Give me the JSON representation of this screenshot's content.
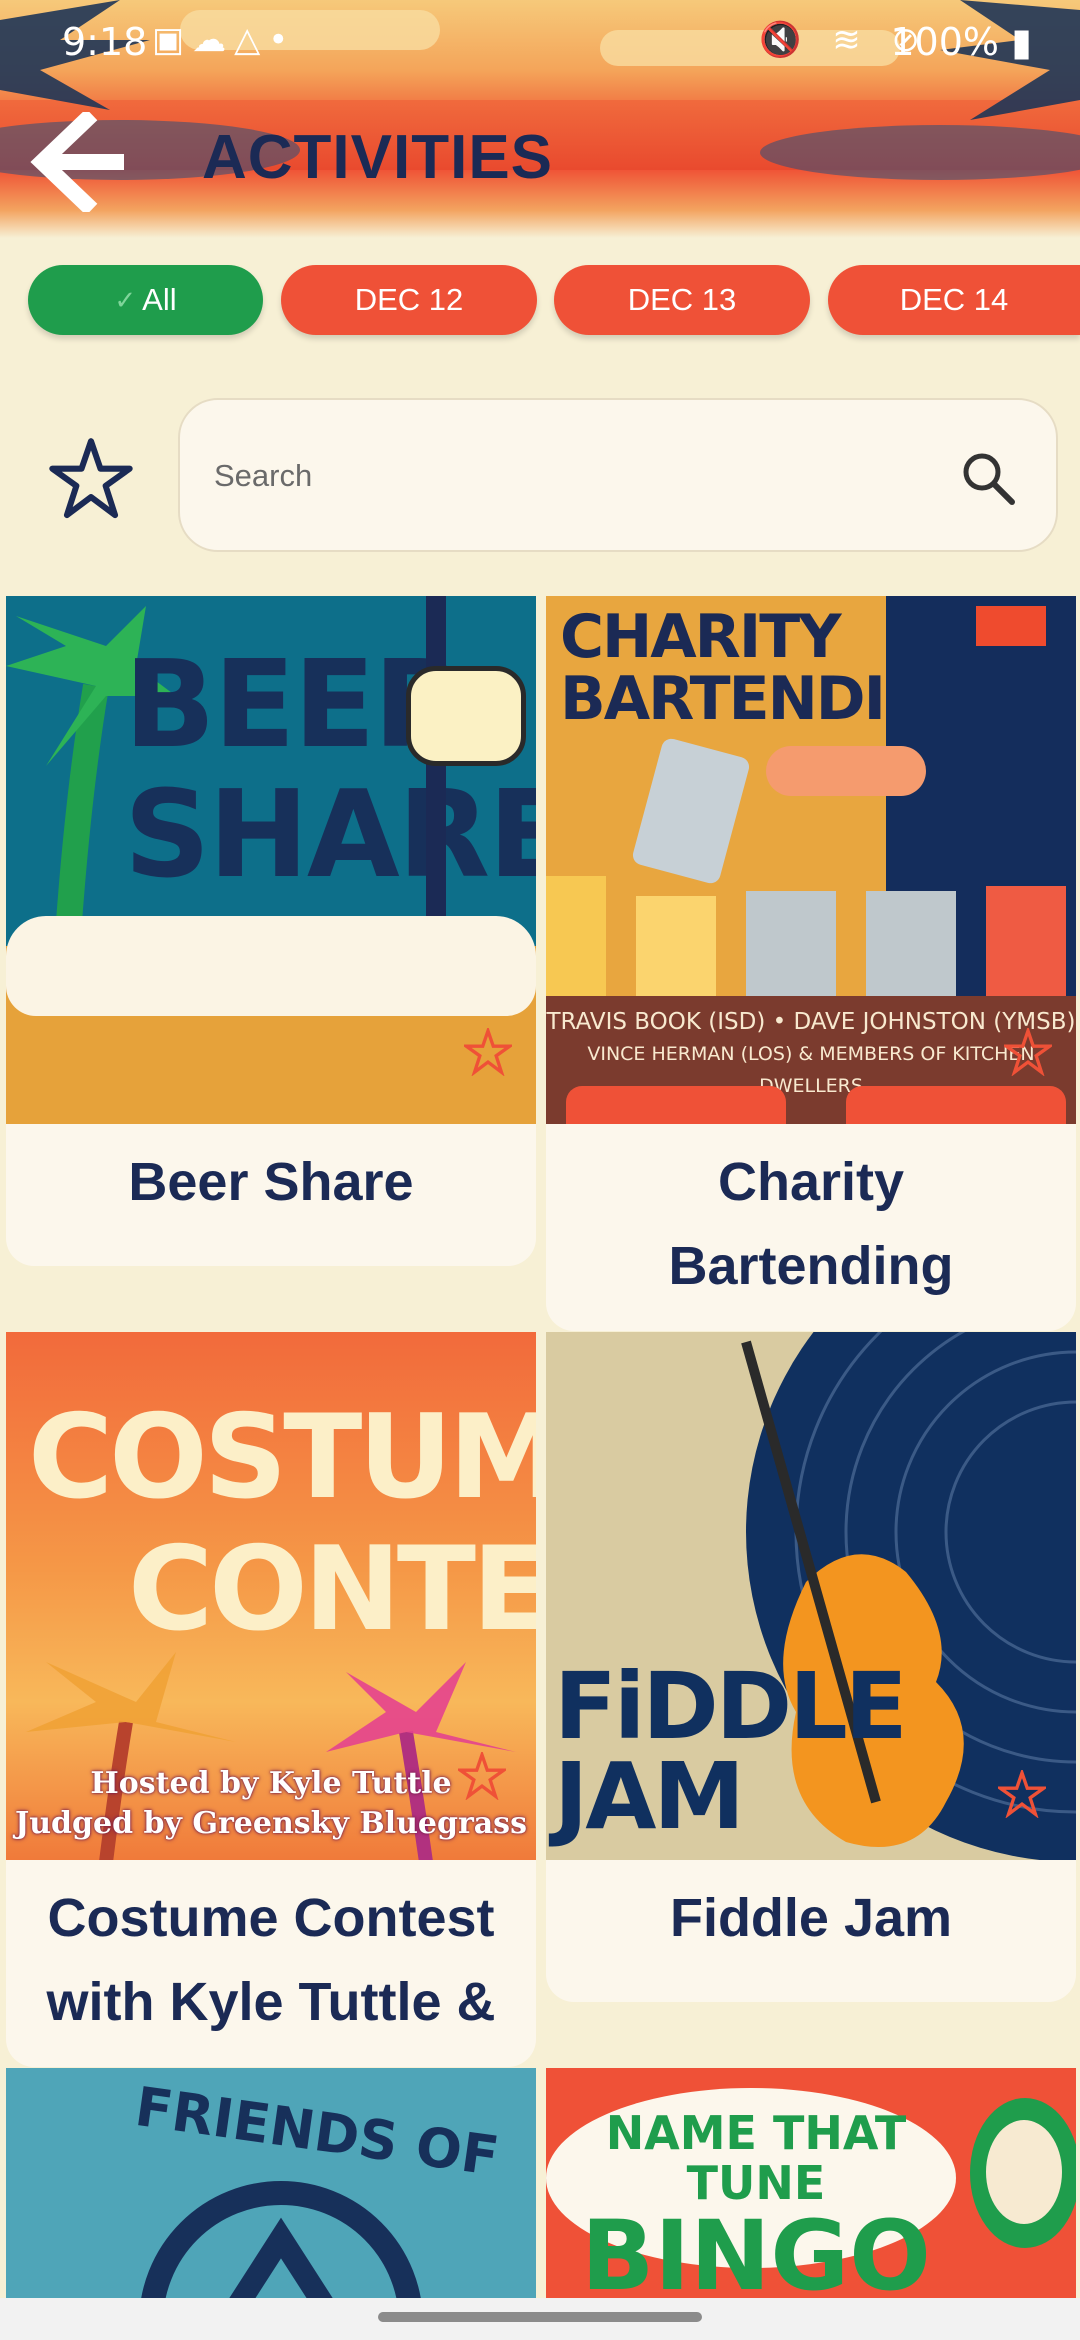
{
  "status_bar": {
    "time": "9:18",
    "battery": "100%"
  },
  "header": {
    "title": "ACTIVITIES"
  },
  "filters": [
    {
      "label": "All",
      "active": true
    },
    {
      "label": "DEC 12",
      "active": false
    },
    {
      "label": "DEC 13",
      "active": false
    },
    {
      "label": "DEC 14",
      "active": false
    }
  ],
  "search": {
    "placeholder": "Search"
  },
  "cards": [
    {
      "title": "Beer Share",
      "poster_lines": [
        "BEER",
        "SHARE"
      ]
    },
    {
      "title": "Charity Bartending",
      "poster_lines": [
        "CHARITY",
        "BARTENDING"
      ],
      "poster_credits": [
        "TRAVIS BOOK (ISD) • DAVE JOHNSTON (YMSB)",
        "VINCE HERMAN (LOS) & MEMBERS OF KITCHEN DWELLERS"
      ]
    },
    {
      "title": "Costume Contest with Kyle Tuttle &",
      "poster_lines": [
        "COSTUME",
        "CONTEST"
      ],
      "poster_credits": [
        "Hosted by Kyle Tuttle",
        "Judged by Greensky Bluegrass"
      ]
    },
    {
      "title": "Fiddle Jam",
      "poster_lines": [
        "FiDDLE",
        "JAM"
      ]
    },
    {
      "title": "",
      "poster_lines": [
        "FRIENDS OF"
      ]
    },
    {
      "title": "",
      "poster_lines": [
        "NAME THAT TUNE",
        "BINGO"
      ]
    }
  ],
  "colors": {
    "navy": "#1b2a55",
    "chip_active": "#1f9d4c",
    "chip_inactive": "#ef5137",
    "background": "#f7f0d5"
  }
}
